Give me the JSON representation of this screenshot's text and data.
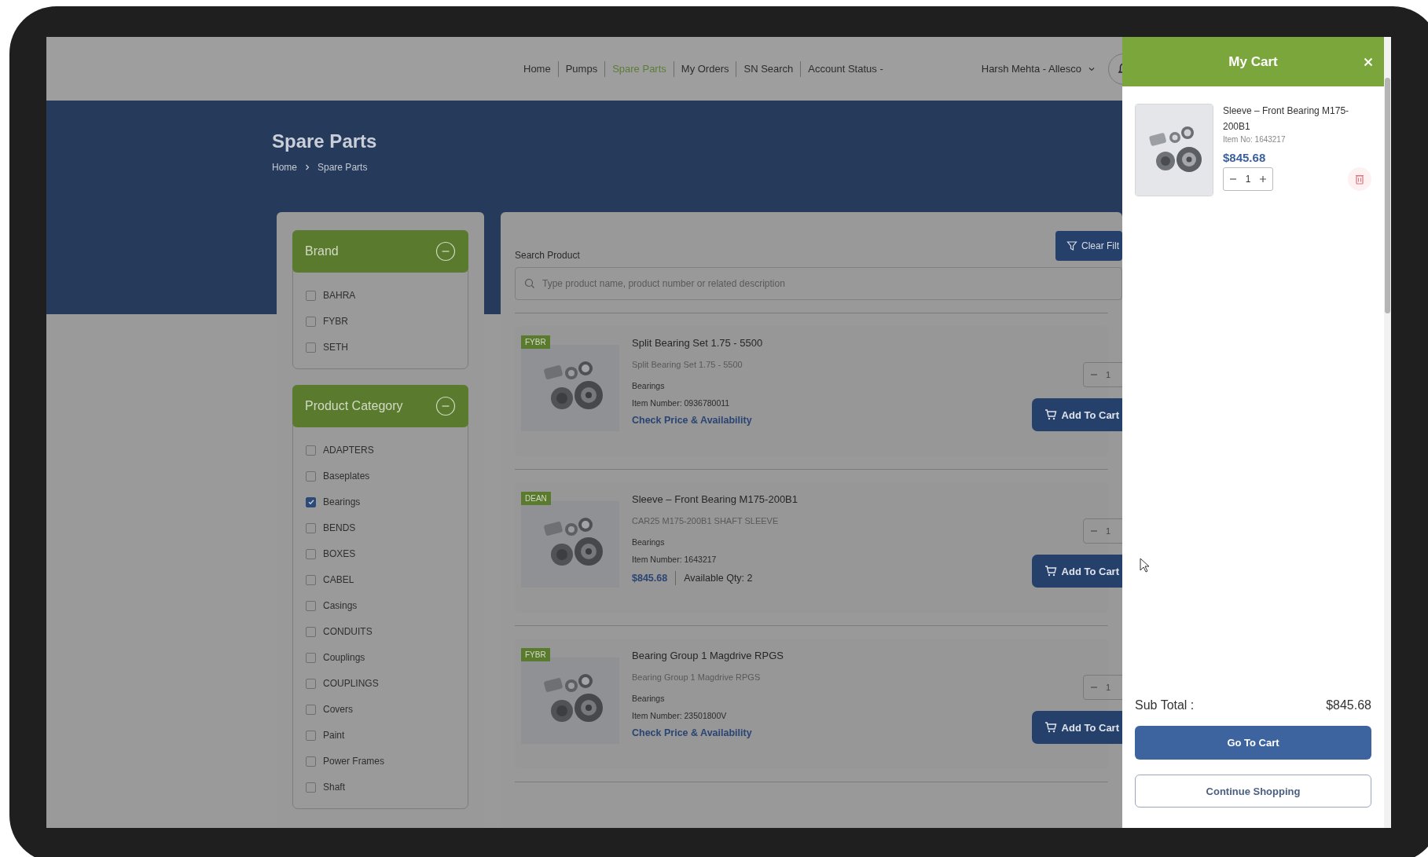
{
  "nav": {
    "links": [
      {
        "label": "Home",
        "selected": false
      },
      {
        "label": "Pumps",
        "selected": false
      },
      {
        "label": "Spare Parts",
        "selected": true
      },
      {
        "label": "My Orders",
        "selected": false
      },
      {
        "label": "SN Search",
        "selected": false
      },
      {
        "label": "Account Status -",
        "selected": false
      }
    ],
    "user": "Harsh Mehta - Allesco"
  },
  "banner": {
    "title": "Spare Parts",
    "breadcrumb": [
      "Home",
      "Spare Parts"
    ]
  },
  "filters": [
    {
      "title": "Brand",
      "expanded": true,
      "options": [
        {
          "label": "BAHRA",
          "checked": false
        },
        {
          "label": "FYBR",
          "checked": false
        },
        {
          "label": "SETH",
          "checked": false
        }
      ]
    },
    {
      "title": "Product Category",
      "expanded": true,
      "options": [
        {
          "label": "ADAPTERS",
          "checked": false
        },
        {
          "label": "Baseplates",
          "checked": false
        },
        {
          "label": "Bearings",
          "checked": true
        },
        {
          "label": "BENDS",
          "checked": false
        },
        {
          "label": "BOXES",
          "checked": false
        },
        {
          "label": "CABEL",
          "checked": false
        },
        {
          "label": "Casings",
          "checked": false
        },
        {
          "label": "CONDUITS",
          "checked": false
        },
        {
          "label": "Couplings",
          "checked": false
        },
        {
          "label": "COUPLINGS",
          "checked": false
        },
        {
          "label": "Covers",
          "checked": false
        },
        {
          "label": "Paint",
          "checked": false
        },
        {
          "label": "Power Frames",
          "checked": false
        },
        {
          "label": "Shaft",
          "checked": false
        }
      ]
    }
  ],
  "search": {
    "label": "Search Product",
    "placeholder": "Type product name, product number or related description",
    "clear_button": "Clear Filt"
  },
  "products": [
    {
      "kind": "check",
      "badge": "FYBR",
      "name": "Split Bearing Set 1.75 - 5500",
      "description": "Split Bearing Set 1.75 - 5500",
      "category": "Bearings",
      "item_number": "Item Number: 0936780011",
      "link": "Check Price & Availability",
      "quantity": "1",
      "button": "Add To Cart"
    },
    {
      "kind": "price",
      "badge": "DEAN",
      "name": "Sleeve – Front Bearing M175-200B1",
      "description": "CAR25 M175-200B1 SHAFT SLEEVE",
      "category": "Bearings",
      "item_number": "Item Number: 1643217",
      "price": "$845.68",
      "availability": "Available Qty: 2",
      "quantity": "1",
      "button": "Add To Cart"
    },
    {
      "kind": "check",
      "badge": "FYBR",
      "name": "Bearing Group 1 Magdrive RPGS",
      "description": "Bearing Group 1 Magdrive RPGS",
      "category": "Bearings",
      "item_number": "Item Number: 23501800V",
      "link": "Check Price & Availability",
      "quantity": "1",
      "button": "Add To Cart"
    }
  ],
  "cart": {
    "title": "My Cart",
    "items": [
      {
        "name": "Sleeve – Front Bearing M175-200B1",
        "item_no": "Item No: 1643217",
        "price": "$845.68",
        "quantity": "1"
      }
    ],
    "subtotal_label": "Sub Total :",
    "subtotal": "$845.68",
    "primary_button": "Go To Cart",
    "secondary_button": "Continue Shopping"
  }
}
